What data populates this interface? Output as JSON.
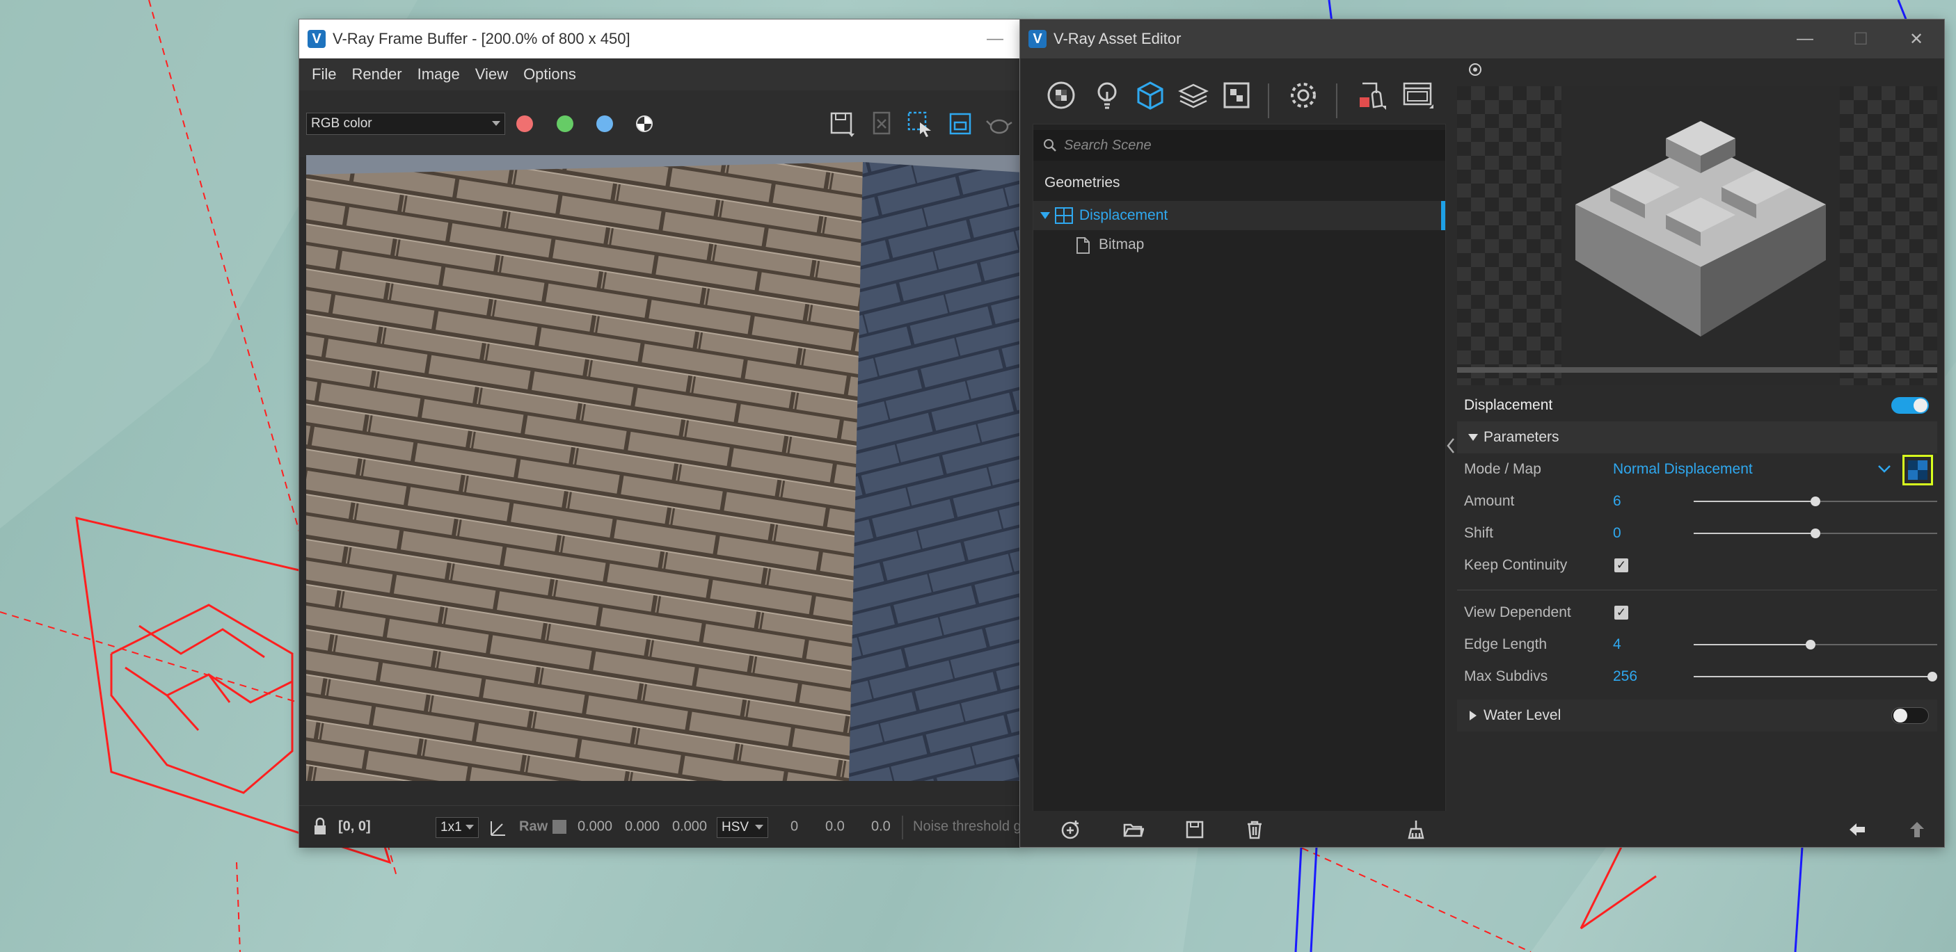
{
  "frame_buffer": {
    "title": "V-Ray Frame Buffer - [200.0% of 800 x 450]",
    "logo": "V",
    "menu": [
      "File",
      "Render",
      "Image",
      "View",
      "Options"
    ],
    "channel": "RGB color",
    "status": {
      "coords": "[0, 0]",
      "ratio": "1x1",
      "raw_label": "Raw",
      "rgb_values": [
        "0.000",
        "0.000",
        "0.000"
      ],
      "color_mode": "HSV",
      "hsv_values": [
        "0",
        "0.0",
        "0.0"
      ],
      "noise": "Noise threshold g"
    }
  },
  "asset_editor": {
    "title": "V-Ray Asset Editor",
    "logo": "V",
    "search_placeholder": "Search Scene",
    "outliner_header": "Geometries",
    "tree": [
      {
        "label": "Displacement",
        "selected": true
      },
      {
        "label": "Bitmap",
        "selected": false
      }
    ],
    "section_title": "Displacement",
    "parameters_label": "Parameters",
    "params": {
      "mode_label": "Mode / Map",
      "mode_value": "Normal Displacement",
      "amount_label": "Amount",
      "amount_value": "6",
      "amount_frac": 0.5,
      "shift_label": "Shift",
      "shift_value": "0",
      "shift_frac": 0.5,
      "keep_continuity_label": "Keep Continuity",
      "keep_continuity": true,
      "view_dependent_label": "View Dependent",
      "view_dependent": true,
      "edge_length_label": "Edge Length",
      "edge_length_value": "4",
      "edge_length_frac": 0.48,
      "max_subdivs_label": "Max Subdivs",
      "max_subdivs_value": "256",
      "max_subdivs_frac": 0.98
    },
    "water_level_label": "Water Level",
    "displacement_enabled": true,
    "water_level_enabled": false
  },
  "colors": {
    "accent": "#1ea0e6",
    "highlight_box": "#d8ff1e",
    "red_dot": "#f07070",
    "green_dot": "#66cc66",
    "blue_dot": "#6cb4f0"
  }
}
